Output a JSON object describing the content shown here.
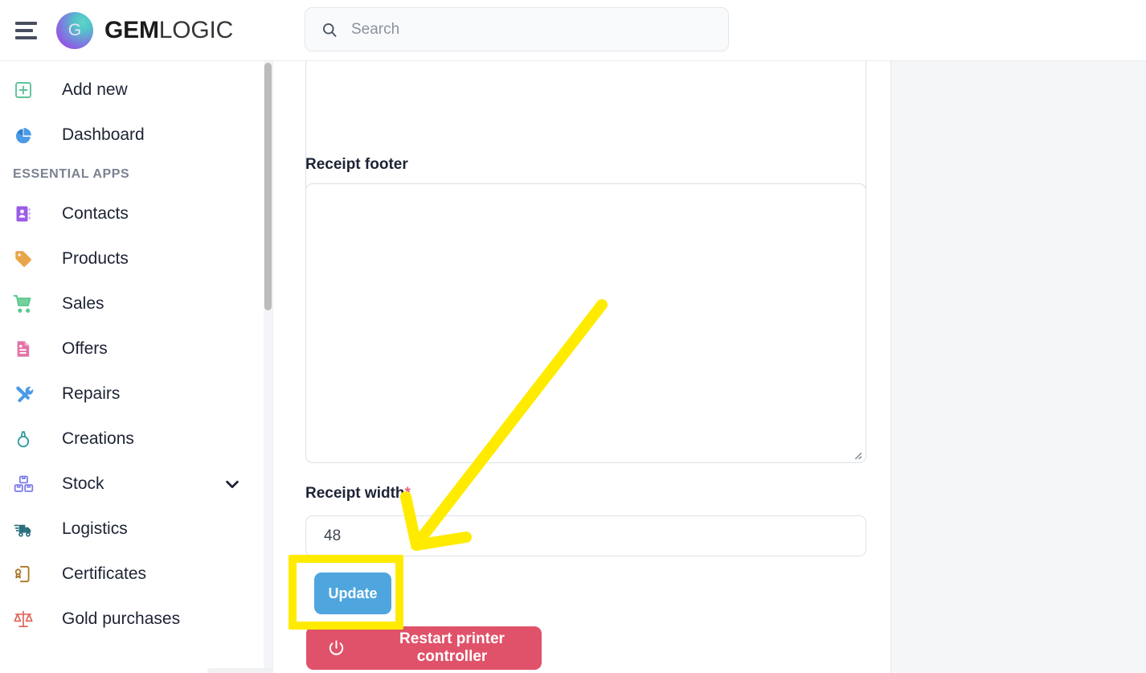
{
  "header": {
    "menu_icon": "hamburger-icon",
    "logo_bold": "GEM",
    "logo_light": "LOGIC",
    "logo_letter": "G",
    "search": {
      "icon": "search-icon",
      "placeholder": "Search",
      "value": ""
    }
  },
  "sidebar": {
    "section_label": "ESSENTIAL APPS",
    "top_items": [
      {
        "label": "Add new",
        "icon": "plus-square-icon",
        "color": "#5ec39a"
      },
      {
        "label": "Dashboard",
        "icon": "pie-chart-icon",
        "color": "#4a9ae8"
      }
    ],
    "app_items": [
      {
        "label": "Contacts",
        "icon": "address-book-icon",
        "color": "#9b5ce6",
        "expandable": false
      },
      {
        "label": "Products",
        "icon": "price-tag-icon",
        "color": "#e8a54a",
        "expandable": false
      },
      {
        "label": "Sales",
        "icon": "shopping-cart-icon",
        "color": "#5dc98e",
        "expandable": false
      },
      {
        "label": "Offers",
        "icon": "offer-document-icon",
        "color": "#e274a8",
        "expandable": false
      },
      {
        "label": "Repairs",
        "icon": "tools-icon",
        "color": "#4a9ae8",
        "expandable": false
      },
      {
        "label": "Creations",
        "icon": "ring-icon",
        "color": "#2e9aa0",
        "expandable": false
      },
      {
        "label": "Stock",
        "icon": "boxes-icon",
        "color": "#7b7ce8",
        "expandable": true,
        "chevron": "chevron-down-icon"
      },
      {
        "label": "Logistics",
        "icon": "delivery-truck-icon",
        "color": "#2b6f7e",
        "expandable": false
      },
      {
        "label": "Certificates",
        "icon": "certificate-icon",
        "color": "#a87423",
        "expandable": false
      },
      {
        "label": "Gold purchases",
        "icon": "scales-icon",
        "color": "#e0695c",
        "expandable": false
      }
    ]
  },
  "main": {
    "receipt_header_textarea": {
      "value": "",
      "resize_handle": "resize-grip-icon"
    },
    "receipt_footer_label": "Receipt footer",
    "receipt_footer_textarea": {
      "value": "",
      "resize_handle": "resize-grip-icon"
    },
    "receipt_width_label": "Receipt width",
    "required_marker": "*",
    "receipt_width_value": "48",
    "receipt_width_placeholder": "",
    "update_button": "Update",
    "restart_button": "Restart printer controller",
    "restart_icon": "power-icon"
  },
  "annotations": {
    "arrow_color": "#ffeb00",
    "highlight_color": "#ffeb00",
    "highlight_target": "Update",
    "arrow_points_to": "Update"
  },
  "colors": {
    "update_blue": "#4fa6de",
    "restart_red": "#e0526a",
    "required_red": "#e8657c",
    "text_dark": "#1d2334",
    "right_pane_bg": "#f4f6f8"
  }
}
